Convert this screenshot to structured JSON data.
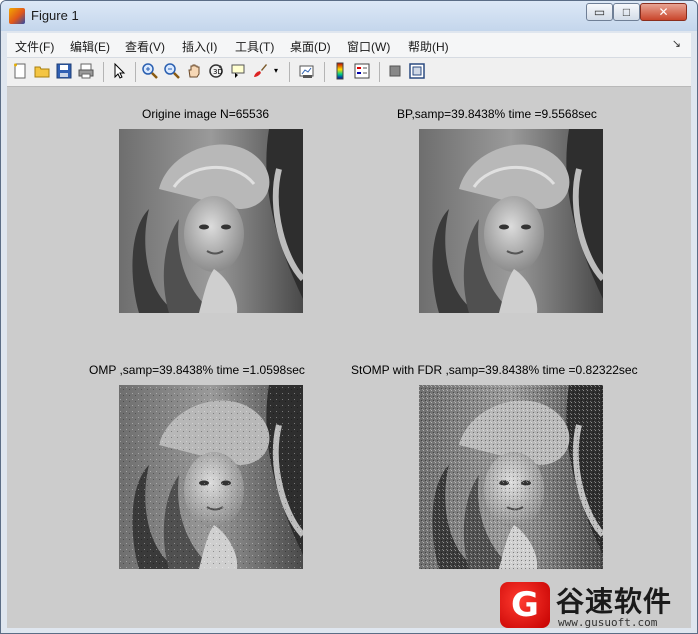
{
  "window": {
    "title": "Figure 1"
  },
  "title_controls": {
    "minimize": "▭",
    "maximize": "□",
    "close": "✕"
  },
  "menu": {
    "items": [
      "文件(F)",
      "编辑(E)",
      "查看(V)",
      "插入(I)",
      "工具(T)",
      "桌面(D)",
      "窗口(W)",
      "帮助(H)"
    ],
    "overflow": "↘"
  },
  "toolbar": {
    "icons": [
      "new-figure-icon",
      "open-file-icon",
      "save-icon",
      "print-icon",
      "edit-plot-icon",
      "zoom-in-icon",
      "zoom-out-icon",
      "pan-icon",
      "rotate-3d-icon",
      "data-cursor-icon",
      "brush-icon",
      "link-plot-icon",
      "colorbar-icon",
      "legend-icon",
      "hide-plot-tools-icon",
      "show-plot-tools-icon"
    ]
  },
  "subplots": [
    {
      "title": "Origine image N=65536"
    },
    {
      "title": "BP,samp=39.8438%  time =9.5568sec"
    },
    {
      "title": "OMP ,samp=39.8438%  time =1.0598sec"
    },
    {
      "title": "StOMP with FDR ,samp=39.8438%  time =0.82322sec"
    }
  ],
  "watermark": {
    "logo_letter": "G",
    "text": "谷速软件",
    "url": "www.gusuoft.com"
  },
  "colors": {
    "figure_bg": "#cccccc",
    "close_button": "#c9452b",
    "watermark_red": "#d50000"
  }
}
